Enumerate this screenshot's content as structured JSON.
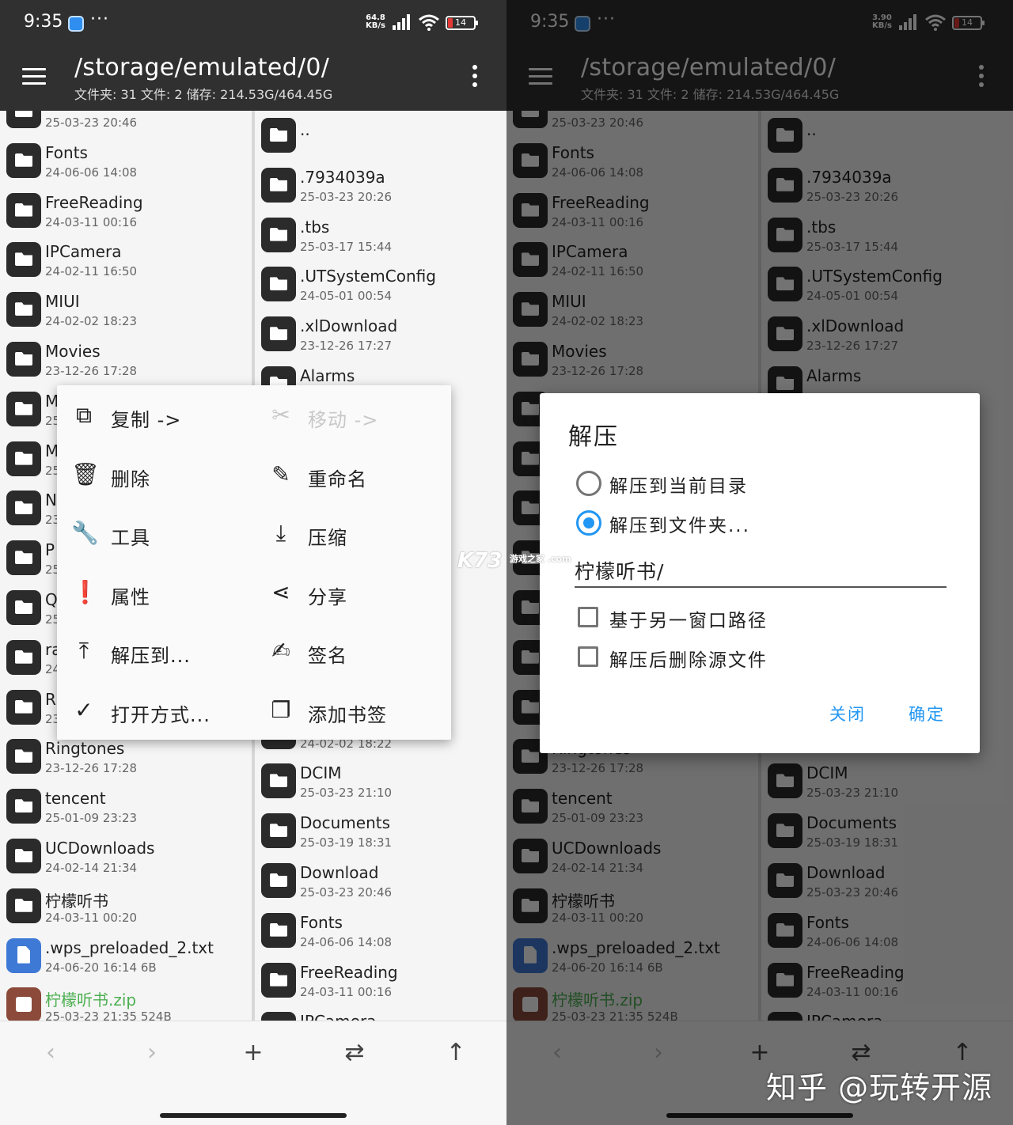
{
  "status": {
    "time": "9:35",
    "dots": "···",
    "left_net": [
      "64.8",
      "KB/s"
    ],
    "right_net": [
      "3.90",
      "KB/s"
    ],
    "battery": "14"
  },
  "toolbar": {
    "path": "/storage/emulated/0/",
    "stats": "文件夹: 31  文件: 2  储存: 214.53G/464.45G"
  },
  "left_pane": [
    {
      "name": "",
      "meta": "25-03-23 20:46",
      "icon": "folder-icon"
    },
    {
      "name": "Fonts",
      "meta": "24-06-06 14:08",
      "icon": "folder-icon"
    },
    {
      "name": "FreeReading",
      "meta": "24-03-11 00:16",
      "icon": "folder-icon"
    },
    {
      "name": "IPCamera",
      "meta": "24-02-11 16:50",
      "icon": "folder-icon"
    },
    {
      "name": "MIUI",
      "meta": "24-02-02 18:23",
      "icon": "folder-icon"
    },
    {
      "name": "Movies",
      "meta": "23-12-26 17:28",
      "icon": "folder-icon"
    },
    {
      "name": "MT2",
      "meta": "25",
      "icon": "folder-icon"
    },
    {
      "name": "M",
      "meta": "25",
      "icon": "folder-icon"
    },
    {
      "name": "N",
      "meta": "23",
      "icon": "folder-icon"
    },
    {
      "name": "P",
      "meta": "25",
      "icon": "folder-icon"
    },
    {
      "name": "Q",
      "meta": "25",
      "icon": "folder-icon"
    },
    {
      "name": "ra",
      "meta": "24",
      "icon": "folder-icon"
    },
    {
      "name": "R",
      "meta": "23",
      "icon": "folder-icon"
    },
    {
      "name": "Ringtones",
      "meta": "23-12-26 17:28",
      "icon": "folder-icon"
    },
    {
      "name": "tencent",
      "meta": "25-01-09 23:23",
      "icon": "folder-icon"
    },
    {
      "name": "UCDownloads",
      "meta": "24-02-14 21:34",
      "icon": "folder-icon"
    },
    {
      "name": "柠檬听书",
      "meta": "24-03-11 00:20",
      "icon": "folder-icon"
    },
    {
      "name": ".wps_preloaded_2.txt",
      "meta": "24-06-20 16:14  6B",
      "icon": "text-file-icon"
    },
    {
      "name": "柠檬听书.zip",
      "meta": "25-03-23 21:35  524B",
      "icon": "zip-file-icon"
    }
  ],
  "right_pane": [
    {
      "name": "..",
      "meta": "",
      "icon": "folder-icon"
    },
    {
      "name": ".7934039a",
      "meta": "25-03-23 20:26",
      "icon": "folder-icon"
    },
    {
      "name": ".tbs",
      "meta": "25-03-17 15:44",
      "icon": "folder-icon"
    },
    {
      "name": ".UTSystemConfig",
      "meta": "24-05-01 00:54",
      "icon": "folder-icon"
    },
    {
      "name": ".xlDownload",
      "meta": "23-12-26 17:27",
      "icon": "folder-icon"
    },
    {
      "name": "Alarms",
      "meta": "",
      "icon": "folder-icon"
    },
    {
      "name": "",
      "meta": "",
      "icon": "folder-icon"
    },
    {
      "name": "",
      "meta": "",
      "icon": "folder-icon"
    },
    {
      "name": "",
      "meta": "",
      "icon": "folder-icon"
    },
    {
      "name": "",
      "meta": "",
      "icon": "folder-icon"
    },
    {
      "name": "",
      "meta": "",
      "icon": "folder-icon"
    },
    {
      "name": "",
      "meta": "",
      "icon": "folder-icon"
    },
    {
      "name": "",
      "meta": "24-02-02 18:22",
      "icon": "folder-icon"
    },
    {
      "name": "DCIM",
      "meta": "25-03-23 21:10",
      "icon": "folder-icon"
    },
    {
      "name": "Documents",
      "meta": "25-03-19 18:31",
      "icon": "folder-icon"
    },
    {
      "name": "Download",
      "meta": "25-03-23 20:46",
      "icon": "folder-icon"
    },
    {
      "name": "Fonts",
      "meta": "24-06-06 14:08",
      "icon": "folder-icon"
    },
    {
      "name": "FreeReading",
      "meta": "24-03-11 00:16",
      "icon": "folder-icon"
    },
    {
      "name": "IPCamera",
      "meta": "",
      "icon": "folder-icon"
    }
  ],
  "context_menu": [
    {
      "label": "复制 ->",
      "icon": "copy-icon",
      "glyph": "⧉",
      "disabled": false
    },
    {
      "label": "移动 ->",
      "icon": "scissors-icon",
      "glyph": "✂",
      "disabled": true
    },
    {
      "label": "删除",
      "icon": "trash-icon",
      "glyph": "🗑",
      "disabled": false
    },
    {
      "label": "重命名",
      "icon": "pencil-icon",
      "glyph": "✎",
      "disabled": false
    },
    {
      "label": "工具",
      "icon": "wrench-icon",
      "glyph": "🔧",
      "disabled": false
    },
    {
      "label": "压缩",
      "icon": "download-icon",
      "glyph": "⤓",
      "disabled": false
    },
    {
      "label": "属性",
      "icon": "info-icon",
      "glyph": "❗",
      "disabled": false
    },
    {
      "label": "分享",
      "icon": "share-icon",
      "glyph": "⋖",
      "disabled": false
    },
    {
      "label": "解压到...",
      "icon": "upload-icon",
      "glyph": "⤒",
      "disabled": false
    },
    {
      "label": "签名",
      "icon": "signature-icon",
      "glyph": "✍",
      "disabled": false
    },
    {
      "label": "打开方式...",
      "icon": "check-icon",
      "glyph": "✓",
      "disabled": false
    },
    {
      "label": "添加书签",
      "icon": "bookmark-icon",
      "glyph": "❐",
      "disabled": false
    }
  ],
  "bottom_nav": [
    {
      "name": "back-icon",
      "glyph": "‹",
      "disabled": true
    },
    {
      "name": "forward-icon",
      "glyph": "›",
      "disabled": true
    },
    {
      "name": "add-icon",
      "glyph": "+",
      "disabled": false
    },
    {
      "name": "swap-icon",
      "glyph": "⇄",
      "disabled": false
    },
    {
      "name": "up-icon",
      "glyph": "↑",
      "disabled": false
    }
  ],
  "dialog": {
    "title": "解压",
    "radio_options": [
      "解压到当前目录",
      "解压到文件夹..."
    ],
    "selected": 1,
    "input_value": "柠檬听书/",
    "checkboxes": [
      "基于另一窗口路径",
      "解压后删除源文件"
    ],
    "close_label": "关闭",
    "ok_label": "确定"
  },
  "watermark": {
    "text": "K73",
    "sub": "游戏之家 .com"
  },
  "credit": "知乎 @玩转开源",
  "colors": {
    "bar": "#303030",
    "accent": "#2196f3",
    "zip_green": "#4caf50"
  }
}
